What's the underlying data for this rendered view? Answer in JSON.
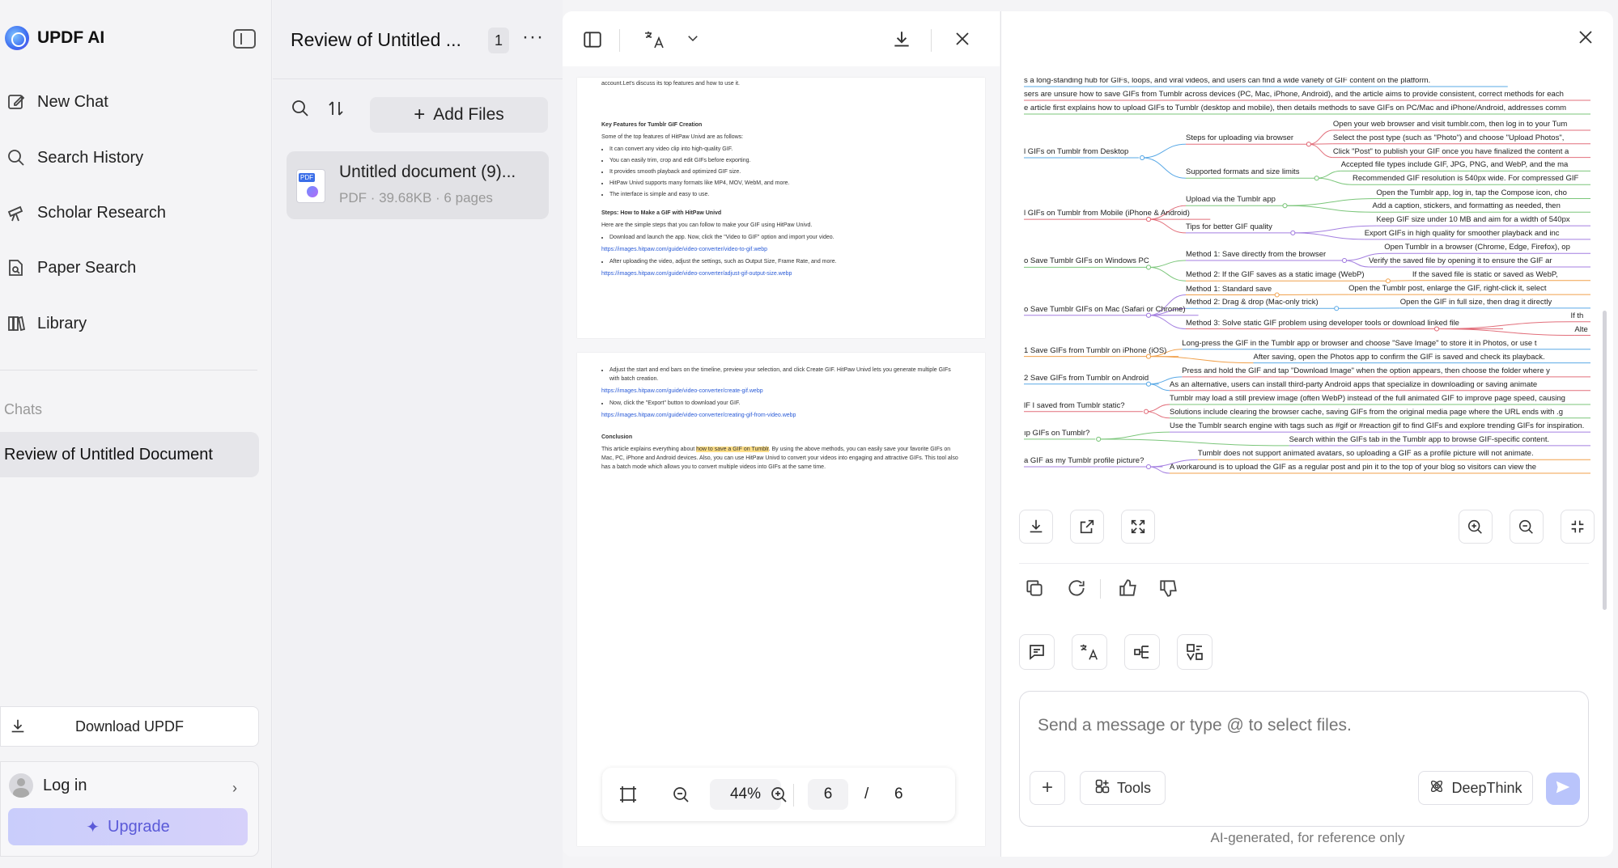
{
  "sidebar": {
    "brand": "UPDF AI",
    "nav": [
      {
        "label": "New Chat",
        "icon": "edit-icon"
      },
      {
        "label": "Search History",
        "icon": "search-icon"
      },
      {
        "label": "Scholar Research",
        "icon": "telescope-icon"
      },
      {
        "label": "Paper Search",
        "icon": "paper-search-icon"
      },
      {
        "label": "Library",
        "icon": "library-icon"
      }
    ],
    "chats_label": "Chats",
    "active_chat": "Review of Untitled Document",
    "download_label": "Download UPDF",
    "login_label": "Log in",
    "upgrade_label": "Upgrade"
  },
  "files": {
    "title": "Review of Untitled ...",
    "count": "1",
    "add_files_label": "Add Files",
    "file_name": "Untitled document (9)...",
    "file_meta": "PDF · 39.68KB · 6 pages"
  },
  "viewer": {
    "page5": {
      "top_text": "account.Let's discuss its top features and how to use it.",
      "h1": "Key Features for Tumblr GIF Creation",
      "intro1": "Some of the top features of HitPaw Univd are as follows:",
      "features": [
        "It can convert any video clip into high-quality GIF.",
        "You can easily trim, crop and edit GIFs before exporting.",
        "It provides smooth playback and optimized GIF size.",
        "HitPaw Univd supports many formats like MP4, MOV, WebM, and more.",
        "The interface is simple and easy to use."
      ],
      "h2": "Steps: How to Make a GIF with HitPaw Univd",
      "intro2": "Here are the simple steps that you can follow to make your GIF using HitPaw Univd.",
      "step1": "Download and launch the app. Now, click the \"Video to GIF\" option and import your video.",
      "link1": "https://images.hitpaw.com/guide/video-converter/video-to-gif.webp",
      "step2": "After uploading the video, adjust the settings, such as Output Size, Frame Rate, and more.",
      "link2": "https://images.hitpaw.com/guide/video-converter/adjust-gif-output-size.webp"
    },
    "page6": {
      "step3": "Adjust the start and end bars on the timeline, preview your selection, and click Create GIF. HitPaw Univd lets you generate multiple GIFs with batch creation.",
      "link3": "https://images.hitpaw.com/guide/video-converter/create-gif.webp",
      "step4": "Now, click the \"Export\" button to download your GIF.",
      "link4": "https://images.hitpaw.com/guide/video-converter/creating-gif-from-video.webp",
      "h3": "Conclusion",
      "conc_a": "This article explains everything about ",
      "conc_hl": "how to save a GIF on Tumblr",
      "conc_b": ". By using the above methods, you can easily save your favorite GIFs on Mac, PC, iPhone and Android devices. Also, you can use HitPaw Univd to convert your videos into engaging and attractive GIFs. This tool also has a batch mode which allows you to convert multiple videos into GIFs at the same time."
    },
    "zoom": "44%",
    "page_current": "6",
    "page_slash": "/",
    "page_total": "6"
  },
  "mindmap": {
    "lines": [
      "s a long-standing hub for GIFs, loops, and viral videos, and users can find a wide variety of GIF content on the platform.",
      "sers are unsure how to save GIFs from Tumblr across devices (PC, Mac, iPhone, Android), and the article aims to provide consistent, correct methods for each",
      "e article first explains how to upload GIFs to Tumblr (desktop and mobile), then details methods to save GIFs on PC/Mac and iPhone/Android, addresses comm"
    ],
    "nodes": [
      {
        "branch": "l GIFs on Tumblr from Desktop",
        "subs": [
          {
            "sub": "Steps for uploading via browser",
            "leaves": [
              "Open your web browser and visit tumblr.com, then log in to your Tum",
              "Select the post type (such as \"Photo\") and choose \"Upload Photos\",",
              "Click \"Post\" to publish your GIF once you have finalized the content a"
            ]
          },
          {
            "sub": "Supported formats and size limits",
            "leaves": [
              "Accepted file types include GIF, JPG, PNG, and WebP, and the ma",
              "Recommended GIF resolution is 540px wide. For compressed GIF"
            ]
          }
        ]
      },
      {
        "branch": "l GIFs on Tumblr from Mobile (iPhone & Android)",
        "subs": [
          {
            "sub": "Upload via the Tumblr app",
            "leaves": [
              "Open the Tumblr app, log in, tap the Compose icon, cho",
              "Add a caption, stickers, and formatting as needed, then"
            ]
          },
          {
            "sub": "Tips for better GIF quality",
            "leaves": [
              "Keep GIF size under 10 MB and aim for a width of 540px",
              "Export GIFs in high quality for smoother playback and inc"
            ]
          }
        ]
      },
      {
        "branch": "o Save Tumblr GIFs on Windows PC",
        "subs": [
          {
            "sub": "Method 1: Save directly from the browser",
            "leaves": [
              "Open Tumblr in a browser (Chrome, Edge, Firefox), op",
              "Verify the saved file by opening it to ensure the GIF ar"
            ]
          },
          {
            "sub": "Method 2: If the GIF saves as a static image (WebP)",
            "leaves": [
              "If the saved file is static or saved as WebP,"
            ]
          }
        ]
      },
      {
        "branch": "o Save Tumblr GIFs on Mac (Safari or Chrome)",
        "subs": [
          {
            "sub": "Method 1: Standard save",
            "leaves": [
              "Open the Tumblr post, enlarge the GIF, right-click it, select"
            ]
          },
          {
            "sub": "Method 2: Drag & drop (Mac-only trick)",
            "leaves": [
              "Open the GIF in full size, then drag it directly"
            ]
          },
          {
            "sub": "Method 3: Solve static GIF problem using developer tools or download linked file",
            "leaves": [
              "If th",
              "Alte"
            ]
          }
        ]
      },
      {
        "branch": "1 Save GIFs from Tumblr on iPhone (iOS)",
        "subs": [
          {
            "sub": "",
            "leaves": [
              "Long-press the GIF in the Tumblr app or browser and choose \"Save Image\" to store it in Photos, or use t",
              "After saving, open the Photos app to confirm the GIF is saved and check its playback."
            ]
          }
        ]
      },
      {
        "branch": "2 Save GIFs from Tumblr on Android",
        "subs": [
          {
            "sub": "",
            "leaves": [
              "Press and hold the GIF and tap \"Download Image\" when the option appears, then choose the folder where y",
              "As an alternative, users can install third-party Android apps that specialize in downloading or saving animate"
            ]
          }
        ]
      },
      {
        "branch": "lF I saved from Tumblr static?",
        "subs": [
          {
            "sub": "",
            "leaves": [
              "Tumblr may load a still preview image (often WebP) instead of the full animated GIF to improve page speed, causing",
              "Solutions include clearing the browser cache, saving GIFs from the original media page where the URL ends with .g"
            ]
          }
        ]
      },
      {
        "branch": "ıp GIFs on Tumblr?",
        "subs": [
          {
            "sub": "",
            "leaves": [
              "Use the Tumblr search engine with tags such as #gif or #reaction gif to find GIFs and explore trending GIFs for inspiration.",
              "Search within the GIFs tab in the Tumblr app to browse GIF-specific content."
            ]
          }
        ]
      },
      {
        "branch": "a GIF as my Tumblr profile picture?",
        "subs": [
          {
            "sub": "",
            "leaves": [
              "Tumblr does not support animated avatars, so uploading a GIF as a profile picture will not animate.",
              "A workaround is to upload the GIF as a regular post and pin it to the top of your blog so visitors can view the"
            ]
          }
        ]
      }
    ]
  },
  "composer": {
    "placeholder": "Send a message or type @ to select files.",
    "tools_label": "Tools",
    "deepthink_label": "DeepThink"
  },
  "footnote": "AI-generated, for reference only",
  "colors": {
    "accent": "#5b5ad8",
    "send": "#b9c4fb",
    "branch_green": "#7bc67a",
    "branch_blue": "#5aa9e6",
    "branch_red": "#e26f7b",
    "branch_purple": "#a47fe0",
    "branch_orange": "#f0a04b"
  }
}
